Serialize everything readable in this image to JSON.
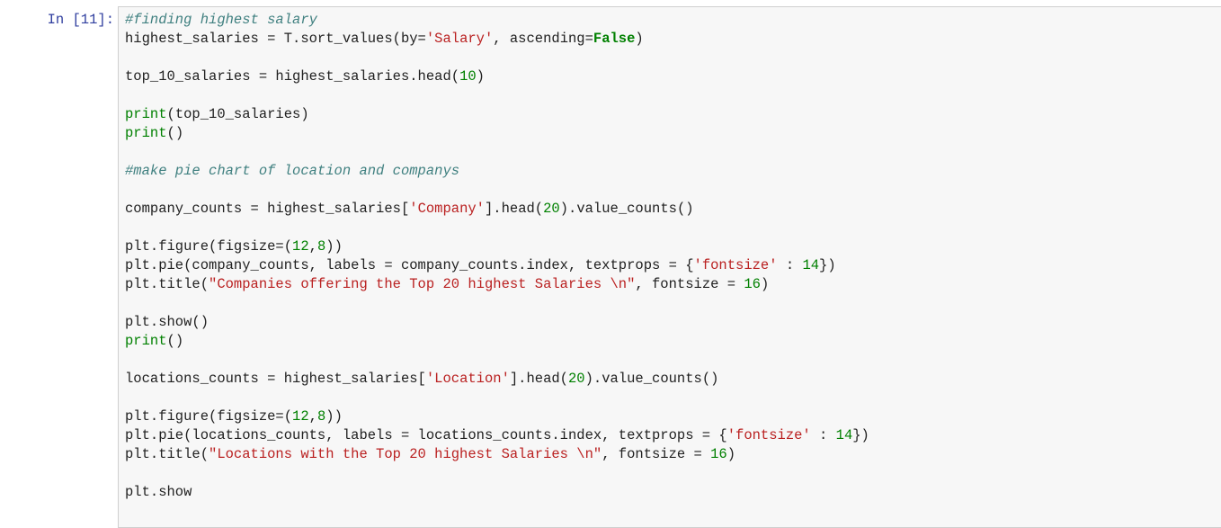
{
  "prompt": "In [11]:",
  "code_lines": [
    [
      [
        "c",
        "#finding highest salary"
      ]
    ],
    [
      [
        "p",
        "highest_salaries = T.sort_values(by="
      ],
      [
        "s",
        "'Salary'"
      ],
      [
        "p",
        ", ascending="
      ],
      [
        "k",
        "False"
      ],
      [
        "p",
        ")"
      ]
    ],
    [],
    [
      [
        "p",
        "top_10_salaries = highest_salaries.head("
      ],
      [
        "n",
        "10"
      ],
      [
        "p",
        ")"
      ]
    ],
    [],
    [
      [
        "b",
        "print"
      ],
      [
        "p",
        "(top_10_salaries)"
      ]
    ],
    [
      [
        "b",
        "print"
      ],
      [
        "p",
        "()"
      ]
    ],
    [],
    [
      [
        "c",
        "#make pie chart of location and companys"
      ]
    ],
    [],
    [
      [
        "p",
        "company_counts = highest_salaries["
      ],
      [
        "s",
        "'Company'"
      ],
      [
        "p",
        "].head("
      ],
      [
        "n",
        "20"
      ],
      [
        "p",
        ").value_counts()"
      ]
    ],
    [],
    [
      [
        "p",
        "plt.figure(figsize=("
      ],
      [
        "n",
        "12"
      ],
      [
        "p",
        ","
      ],
      [
        "n",
        "8"
      ],
      [
        "p",
        "))"
      ]
    ],
    [
      [
        "p",
        "plt.pie(company_counts, labels = company_counts.index, textprops = {"
      ],
      [
        "s",
        "'fontsize'"
      ],
      [
        "p",
        " : "
      ],
      [
        "n",
        "14"
      ],
      [
        "p",
        "})"
      ]
    ],
    [
      [
        "p",
        "plt.title("
      ],
      [
        "s",
        "\"Companies offering the Top 20 highest Salaries \\n\""
      ],
      [
        "p",
        ", fontsize = "
      ],
      [
        "n",
        "16"
      ],
      [
        "p",
        ")"
      ]
    ],
    [],
    [
      [
        "p",
        "plt.show()"
      ]
    ],
    [
      [
        "b",
        "print"
      ],
      [
        "p",
        "()"
      ]
    ],
    [],
    [
      [
        "p",
        "locations_counts = highest_salaries["
      ],
      [
        "s",
        "'Location'"
      ],
      [
        "p",
        "].head("
      ],
      [
        "n",
        "20"
      ],
      [
        "p",
        ").value_counts()"
      ]
    ],
    [],
    [
      [
        "p",
        "plt.figure(figsize=("
      ],
      [
        "n",
        "12"
      ],
      [
        "p",
        ","
      ],
      [
        "n",
        "8"
      ],
      [
        "p",
        "))"
      ]
    ],
    [
      [
        "p",
        "plt.pie(locations_counts, labels = locations_counts.index, textprops = {"
      ],
      [
        "s",
        "'fontsize'"
      ],
      [
        "p",
        " : "
      ],
      [
        "n",
        "14"
      ],
      [
        "p",
        "})"
      ]
    ],
    [
      [
        "p",
        "plt.title("
      ],
      [
        "s",
        "\"Locations with the Top 20 highest Salaries \\n\""
      ],
      [
        "p",
        ", fontsize = "
      ],
      [
        "n",
        "16"
      ],
      [
        "p",
        ")"
      ]
    ],
    [],
    [
      [
        "p",
        "plt.show"
      ]
    ]
  ]
}
